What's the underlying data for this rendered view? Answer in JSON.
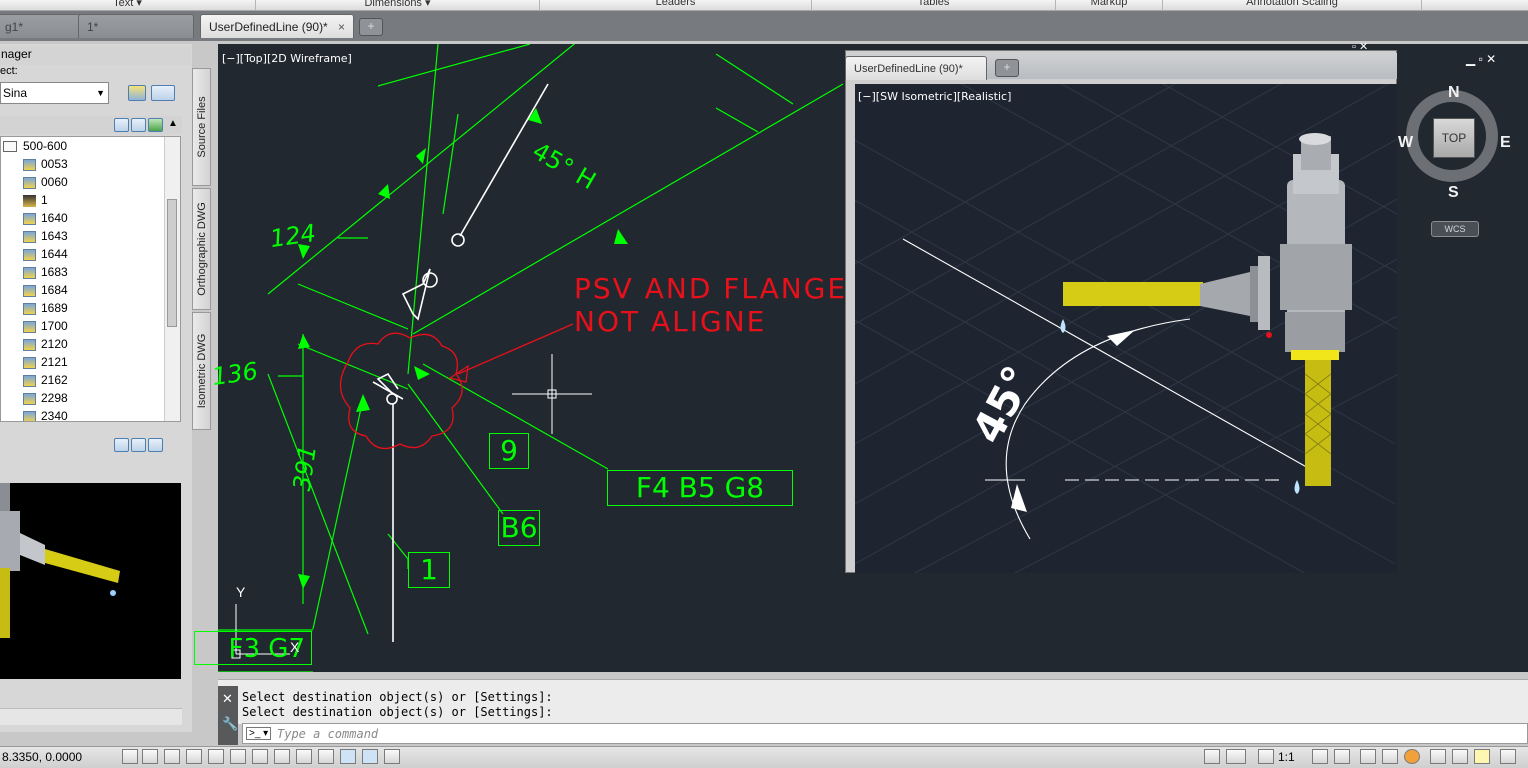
{
  "ribbon": {
    "panels": [
      "Text ▾",
      "Dimensions ▾",
      "Leaders",
      "Tables",
      "Markup",
      "Annotation Scaling"
    ]
  },
  "file_tabs": [
    {
      "label": "g1*"
    },
    {
      "label": "1*"
    },
    {
      "label": "UserDefinedLine (90)*",
      "close": "×"
    }
  ],
  "dwg_manager": {
    "title": "nager",
    "select_label": "ect:",
    "select_value": "Sina",
    "tree": {
      "folder": "500-600",
      "items": [
        "0053",
        "0060",
        "1",
        "1640",
        "1643",
        "1644",
        "1683",
        "1684",
        "1689",
        "1700",
        "2120",
        "2121",
        "2162",
        "2298",
        "2340"
      ]
    },
    "side_tabs": [
      "Source Files",
      "Orthographic DWG",
      "Isometric DWG"
    ]
  },
  "viewport_main": {
    "label": "[−][Top][2D Wireframe]",
    "annotations": {
      "psv_line1": "PSV AND FLANGE",
      "psv_line2": "NOT ALIGNE",
      "box_9": "9",
      "box_f4": "F4 B5 G8",
      "box_b6": "B6",
      "box_1": "1",
      "box_g7": "F3 G7",
      "dim_124": "124",
      "dim_136": "136",
      "dim_391": "391",
      "angle_45h": "45° H",
      "ucs_y": "Y",
      "ucs_x": "X"
    }
  },
  "viewport_iso": {
    "tab": "UserDefinedLine (90)*",
    "label": "[−][SW Isometric][Realistic]",
    "angle_text": "45°",
    "viewcube": {
      "n": "N",
      "s": "S",
      "e": "E",
      "w": "W",
      "top": "TOP",
      "wcs": "WCS"
    }
  },
  "command": {
    "history": [
      "Select destination object(s) or [Settings]:",
      "Select destination object(s) or [Settings]:"
    ],
    "placeholder": "Type a command"
  },
  "status": {
    "coords": "8.3350, 0.0000",
    "scale": "1:1"
  },
  "colors": {
    "canvas": "#212830",
    "annotation_green": "#00ff00",
    "markup_red": "#e8101a",
    "pipe_yellow": "#d6cc15"
  }
}
